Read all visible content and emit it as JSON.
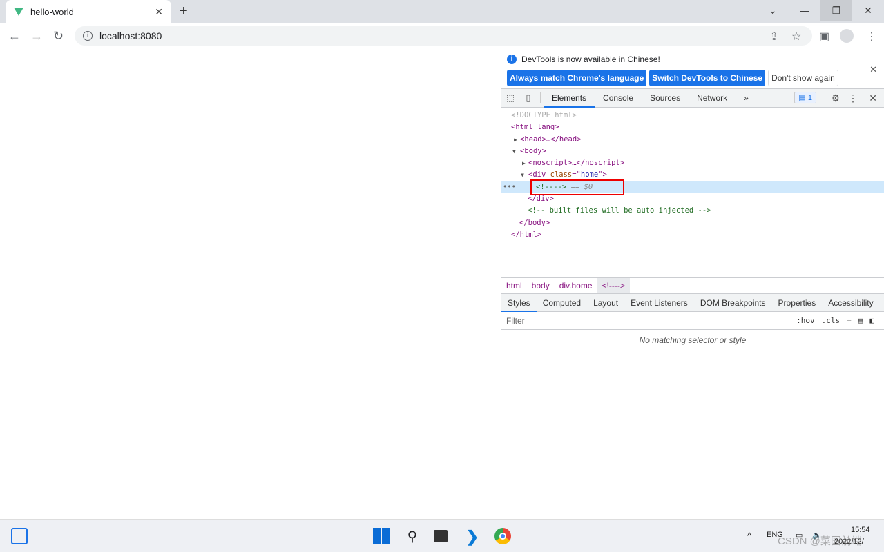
{
  "browser": {
    "tab_title": "hello-world",
    "url": "localhost:8080"
  },
  "devtools": {
    "info": {
      "message": "DevTools is now available in Chinese!",
      "btn_match": "Always match Chrome's language",
      "btn_switch": "Switch DevTools to Chinese",
      "btn_dont": "Don't show again"
    },
    "tabs": [
      "Elements",
      "Console",
      "Sources",
      "Network"
    ],
    "issues_count": "1",
    "dom": {
      "l0": "<!DOCTYPE html>",
      "l1a": "<html",
      " l1b": "",
      "l1": "<html lang>",
      "l2": "<head>…</head>",
      "l3": "<body>",
      "l4": "<noscript>…</noscript>",
      "l5a": "<div ",
      "l5b": "class",
      "l5c": "=\"",
      "l5d": "home",
      "l5e": "\">",
      "l6": "<!---->",
      "l6b": " == $0",
      "l7": "</div>",
      "l8": "<!-- built files will be auto injected -->",
      "l9": "</body>",
      "l10": "</html>"
    },
    "breadcrumbs": [
      "html",
      "body",
      "div.home",
      "<!---->"
    ],
    "style_tabs": [
      "Styles",
      "Computed",
      "Layout",
      "Event Listeners",
      "DOM Breakpoints",
      "Properties",
      "Accessibility"
    ],
    "filter_placeholder": "Filter",
    "hov": ":hov",
    "cls": ".cls",
    "no_match": "No matching selector or style"
  },
  "taskbar": {
    "lang": "ENG",
    "time": "15:54",
    "date": "2022/12/"
  },
  "watermark": "CSDN @菜园前端"
}
